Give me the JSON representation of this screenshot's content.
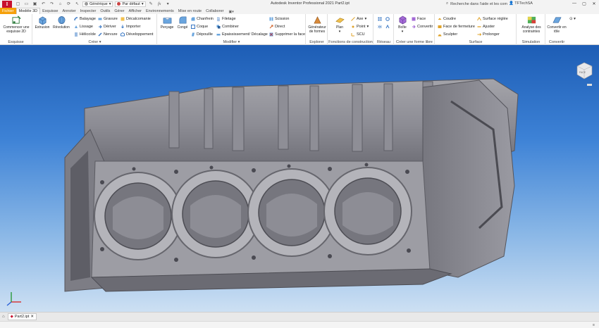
{
  "app": {
    "logo_letter": "I",
    "title": "Autodesk Inventor Professional 2021    Part2.ipt",
    "search_placeholder": "Recherche dans l'aide et les com",
    "user": "TFTechSA",
    "qat": {
      "material": "Générique",
      "appearance": "Par défaut",
      "fx": "fx"
    }
  },
  "tabs": [
    "Fichier",
    "Modèle 3D",
    "Esquisse",
    "Annoter",
    "Inspecter",
    "Outils",
    "Gérer",
    "Afficher",
    "Environnements",
    "Mise en route",
    "Collaborer"
  ],
  "ribbon": {
    "esquisse": {
      "label": "Esquisse",
      "start": "Commencer une esquisse 2D"
    },
    "creer": {
      "label": "Créer",
      "extrusion": "Extrusion",
      "revolution": "Révolution",
      "col1": [
        "Balayage",
        "Lissage",
        "Hélicoïde"
      ],
      "col2": [
        "Gravure",
        "Dériver",
        "Nervure"
      ],
      "col3": [
        "Décalcomanie",
        "Importer",
        "Développement"
      ]
    },
    "modifier": {
      "label": "Modifier",
      "percage": "Perçage",
      "conge": "Congé",
      "col1": [
        "Chanfrein",
        "Coque",
        "Dépouille"
      ],
      "col2": [
        "Filetage",
        "Combiner",
        "Epaississement/ Décalage"
      ],
      "col3": [
        "Scission",
        "Direct",
        "Supprimer la face"
      ]
    },
    "explorer": {
      "label": "Explorer",
      "generator": "Générateur de formes"
    },
    "construction": {
      "label": "Fonctions de construction",
      "plan": "Plan",
      "items": [
        "Axe",
        "Point",
        "SCU"
      ]
    },
    "reseau": {
      "label": "Réseau"
    },
    "forme_libre": {
      "label": "Créer une forme libre",
      "boite": "Boîte",
      "items": [
        "Face",
        "Convertir"
      ]
    },
    "surface": {
      "label": "Surface",
      "col1": [
        "Coudre",
        "Face de fermeture",
        "Sculpter"
      ],
      "col2": [
        "Surface réglée",
        "Ajuster",
        "Prolonger"
      ]
    },
    "simulation": {
      "label": "Simulation",
      "analyse": "Analyse des contraintes"
    },
    "convertir": {
      "label": "Convertir",
      "tole": "Convertir en tôle"
    }
  },
  "viewport": {
    "viewcube_label": "FACE"
  },
  "document_tab": "Part2.ipt",
  "colors": {
    "file_tab": "#f5a00a",
    "logo": "#c8102e",
    "viewport_top": "#1d5db5",
    "viewport_bottom": "#cde0f3"
  }
}
